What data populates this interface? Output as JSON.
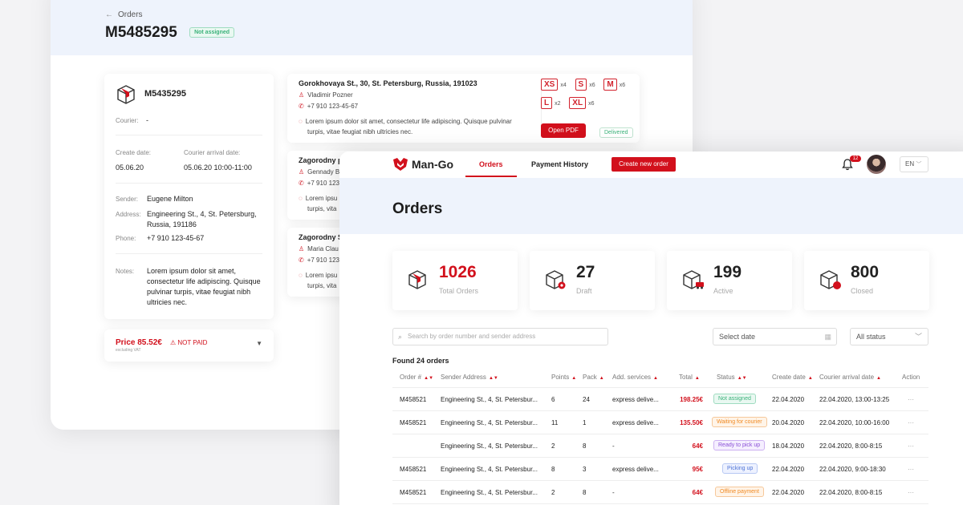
{
  "order_detail": {
    "breadcrumb": "Orders",
    "order_number": "M5485295",
    "status_badge": "Not assigned",
    "info_card": {
      "order_number": "M5435295",
      "courier_label": "Courier:",
      "courier_value": "-",
      "create_date_label": "Create date:",
      "create_date": "05.06.20",
      "arrival_label": "Courier arrival date:",
      "arrival_date": "05.06.20 10:00-11:00",
      "sender_label": "Sender:",
      "sender": "Eugene Milton",
      "address_label": "Address:",
      "address_line1": "Engineering St., 4, St. Petersburg,",
      "address_line2": "Russia, 191186",
      "phone_label": "Phone:",
      "phone": "+7 910 123-45-67",
      "notes_label": "Notes:",
      "notes_lines": [
        "Lorem ipsum dolor sit amet,",
        "consectetur life adipiscing. Quisque",
        "pulvinar turpis, vitae feugiat nibh",
        "ultricies nec."
      ]
    },
    "price_card": {
      "price": "Price 85.52€",
      "price_note": "excluding VAT",
      "payment_status": "NOT PAID"
    },
    "delivery_points": [
      {
        "address": "Gorokhovaya St., 30, St. Petersburg, Russia, 191023",
        "name": "Vladimir Pozner",
        "phone": "+7 910 123-45-67",
        "note_line1": "Lorem ipsum dolor sit amet, consectetur life adipiscing. Quisque pulvinar",
        "note_line2": "turpis, vitae feugiat nibh ultricies nec.",
        "sizes": [
          {
            "size": "XS",
            "qty": "x4"
          },
          {
            "size": "S",
            "qty": "x6"
          },
          {
            "size": "M",
            "qty": "x6"
          },
          {
            "size": "L",
            "qty": "x2"
          },
          {
            "size": "XL",
            "qty": "x6"
          }
        ],
        "open_pdf": "Open PDF",
        "status": "Delivered"
      },
      {
        "address": "Zagorodny p",
        "name": "Gennady B",
        "phone": "+7 910 123",
        "note_line1": "Lorem ipsu",
        "note_line2": "turpis, vita"
      },
      {
        "address": "Zagorodny S",
        "name": "Maria Clau",
        "phone": "+7 910 123",
        "note_line1": "Lorem ipsu",
        "note_line2": "turpis, vita"
      }
    ]
  },
  "app": {
    "brand": "Man-Go",
    "nav": {
      "orders": "Orders",
      "payment_history": "Payment History",
      "create_order": "Create new order"
    },
    "notifications_count": "12",
    "language": "EN",
    "page_title": "Orders",
    "stats": [
      {
        "value": "1026",
        "label": "Total Orders"
      },
      {
        "value": "27",
        "label": "Draft"
      },
      {
        "value": "199",
        "label": "Active"
      },
      {
        "value": "800",
        "label": "Closed"
      }
    ],
    "filters": {
      "search_placeholder": "Search by order number and sender address",
      "date_placeholder": "Select date",
      "status_value": "All status"
    },
    "found_text": "Found 24 orders",
    "table": {
      "headers": {
        "order": "Order #",
        "sender": "Sender Address",
        "points": "Points",
        "pack": "Pack",
        "services": "Add. services",
        "total": "Total",
        "status": "Status",
        "create": "Create date",
        "arrival": "Courier arrival date",
        "action": "Action"
      },
      "rows": [
        {
          "order": "M458521",
          "sender": "Engineering St., 4, St. Petersbur...",
          "points": "6",
          "pack": "24",
          "services": "express delive...",
          "total": "198.25€",
          "status": "Not assigned",
          "status_kind": "green",
          "create": "22.04.2020",
          "arrival": "22.04.2020, 13:00-13:25",
          "action": "···"
        },
        {
          "order": "M458521",
          "sender": "Engineering St., 4, St. Petersbur...",
          "points": "11",
          "pack": "1",
          "services": "express delive...",
          "total": "135.50€",
          "status": "Waiting for courier",
          "status_kind": "orange",
          "create": "20.04.2020",
          "arrival": "22.04.2020, 10:00-16:00",
          "action": "···"
        },
        {
          "order": "",
          "sender": "Engineering St., 4, St. Petersbur...",
          "points": "2",
          "pack": "8",
          "services": "-",
          "total": "64€",
          "status": "Ready to pick up",
          "status_kind": "purple",
          "create": "18.04.2020",
          "arrival": "22.04.2020, 8:00-8:15",
          "action": "···"
        },
        {
          "order": "M458521",
          "sender": "Engineering St., 4, St. Petersbur...",
          "points": "8",
          "pack": "3",
          "services": "express delive...",
          "total": "95€",
          "status": "Picking up",
          "status_kind": "blue",
          "create": "22.04.2020",
          "arrival": "22.04.2020, 9:00-18:30",
          "action": "···"
        },
        {
          "order": "M458521",
          "sender": "Engineering St., 4, St. Petersbur...",
          "points": "2",
          "pack": "8",
          "services": "-",
          "total": "64€",
          "status": "Offline payment",
          "status_kind": "orange",
          "create": "22.04.2020",
          "arrival": "22.04.2020, 8:00-8:15",
          "action": "···"
        }
      ]
    }
  },
  "colors": {
    "accent": "#d2101c",
    "hero_bg": "#eef3fc"
  }
}
